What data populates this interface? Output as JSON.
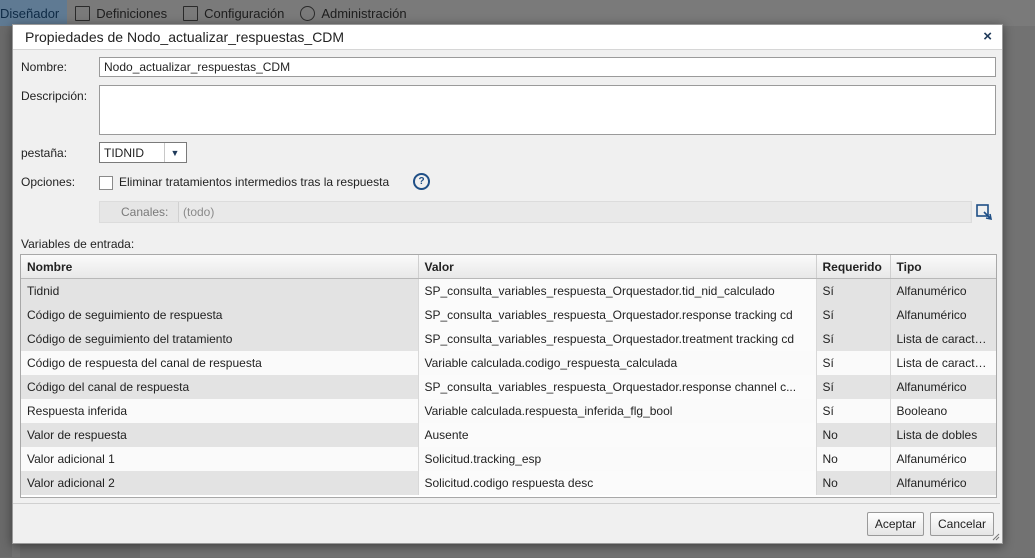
{
  "app_tabs": [
    {
      "label": "Diseñador"
    },
    {
      "label": "Definiciones"
    },
    {
      "label": "Configuración"
    },
    {
      "label": "Administración"
    }
  ],
  "dialog": {
    "title": "Propiedades de Nodo_actualizar_respuestas_CDM",
    "close_label": "×",
    "fields": {
      "nombre_label": "Nombre:",
      "nombre_value": "Nodo_actualizar_respuestas_CDM",
      "descripcion_label": "Descripción:",
      "descripcion_value": "",
      "pestana_label": "pestaña:",
      "pestana_value": "TIDNID",
      "opciones_label": "Opciones:",
      "eliminar_label": "Eliminar tratamientos intermedios tras la respuesta",
      "eliminar_checked": false,
      "help_glyph": "?",
      "canales_label": "Canales:",
      "canales_value": "(todo)"
    },
    "variables_label": "Variables de entrada:",
    "table": {
      "headers": [
        "Nombre",
        "Valor",
        "Requerido",
        "Tipo"
      ],
      "rows": [
        {
          "nombre": "Tidnid",
          "valor": "SP_consulta_variables_respuesta_Orquestador.tid_nid_calculado",
          "requerido": "Sí",
          "tipo": "Alfanumérico"
        },
        {
          "nombre": "Código de seguimiento de respuesta",
          "valor": "SP_consulta_variables_respuesta_Orquestador.response tracking cd",
          "requerido": "Sí",
          "tipo": "Alfanumérico"
        },
        {
          "nombre": "Código de seguimiento del tratamiento",
          "valor": "SP_consulta_variables_respuesta_Orquestador.treatment tracking cd",
          "requerido": "Sí",
          "tipo": "Lista de caracter..."
        },
        {
          "nombre": "Código de respuesta del canal de respuesta",
          "valor": "Variable calculada.codigo_respuesta_calculada",
          "requerido": "Sí",
          "tipo": "Lista de caracter..."
        },
        {
          "nombre": "Código del canal de respuesta",
          "valor": "SP_consulta_variables_respuesta_Orquestador.response channel c...",
          "requerido": "Sí",
          "tipo": "Alfanumérico"
        },
        {
          "nombre": "Respuesta inferida",
          "valor": "Variable calculada.respuesta_inferida_flg_bool",
          "requerido": "Sí",
          "tipo": "Booleano"
        },
        {
          "nombre": "Valor de respuesta",
          "valor": "Ausente",
          "requerido": "No",
          "tipo": "Lista de dobles"
        },
        {
          "nombre": "Valor adicional 1",
          "valor": "Solicitud.tracking_esp",
          "requerido": "No",
          "tipo": "Alfanumérico"
        },
        {
          "nombre": "Valor adicional 2",
          "valor": "Solicitud.codigo respuesta desc",
          "requerido": "No",
          "tipo": "Alfanumérico"
        }
      ]
    },
    "buttons": {
      "accept": "Aceptar",
      "cancel": "Cancelar"
    }
  }
}
